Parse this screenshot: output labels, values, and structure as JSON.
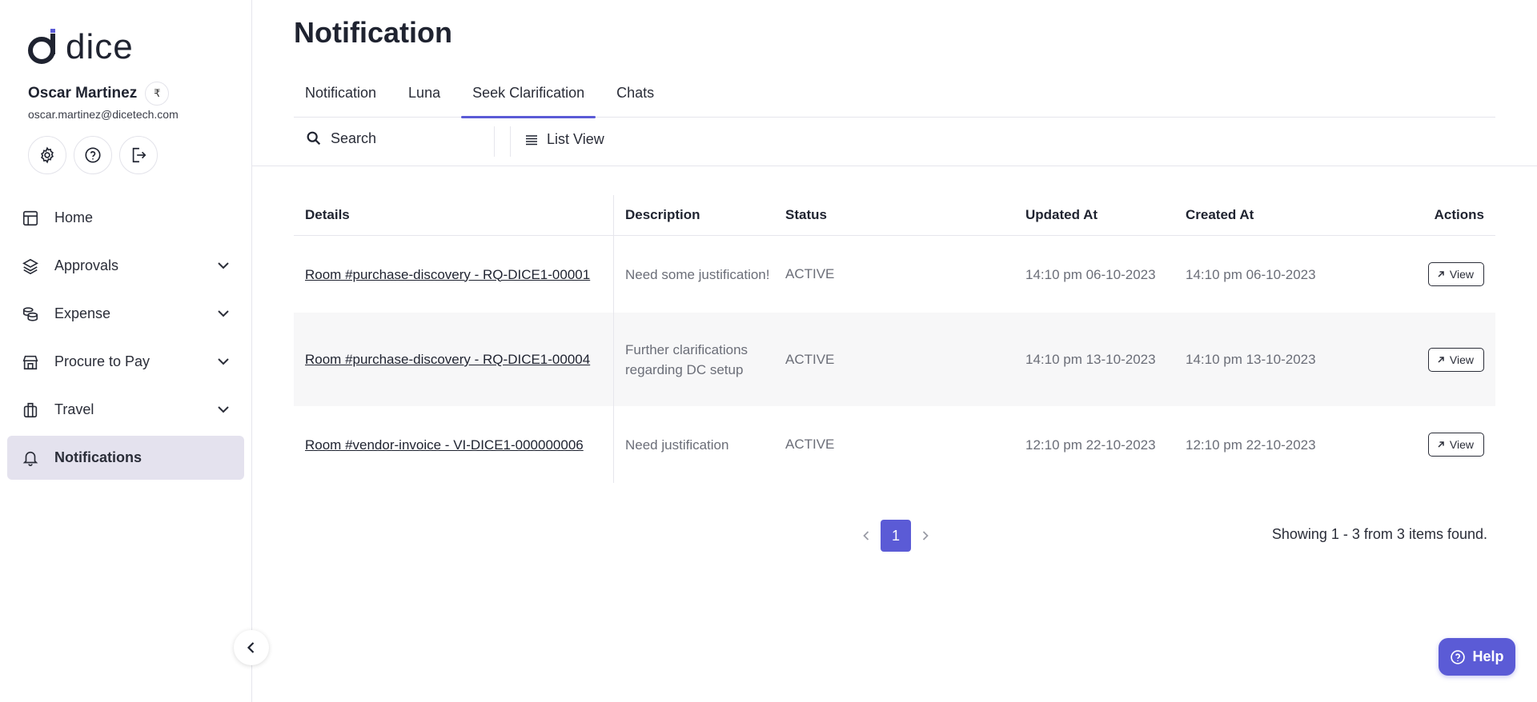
{
  "brand": {
    "name": "dice",
    "accent": "#5b5bd6"
  },
  "user": {
    "name": "Oscar Martinez",
    "currency_symbol": "₹",
    "email": "oscar.martinez@dicetech.com"
  },
  "quick_actions": [
    "gear-icon",
    "help-circle-icon",
    "logout-icon"
  ],
  "nav": {
    "items": [
      {
        "label": "Home",
        "icon": "layout-icon",
        "expandable": false
      },
      {
        "label": "Approvals",
        "icon": "layers-icon",
        "expandable": true
      },
      {
        "label": "Expense",
        "icon": "coins-icon",
        "expandable": true
      },
      {
        "label": "Procure to Pay",
        "icon": "store-icon",
        "expandable": true
      },
      {
        "label": "Travel",
        "icon": "luggage-icon",
        "expandable": true
      },
      {
        "label": "Notifications",
        "icon": "bell-icon",
        "expandable": false,
        "active": true
      }
    ]
  },
  "page": {
    "title": "Notification"
  },
  "tabs": [
    {
      "label": "Notification"
    },
    {
      "label": "Luna"
    },
    {
      "label": "Seek Clarification",
      "active": true
    },
    {
      "label": "Chats"
    }
  ],
  "toolbar": {
    "search_placeholder": "Search",
    "view_label": "List View"
  },
  "table": {
    "headers": {
      "details": "Details",
      "description": "Description",
      "status": "Status",
      "updated": "Updated At",
      "created": "Created At",
      "actions": "Actions"
    },
    "rows": [
      {
        "details": "Room #purchase-discovery - RQ-DICE1-00001",
        "description": "Need some justification!",
        "status": "ACTIVE",
        "updated": "14:10 pm 06-10-2023",
        "created": "14:10 pm 06-10-2023",
        "action": "View"
      },
      {
        "details": "Room #purchase-discovery - RQ-DICE1-00004",
        "description": "Further clarifications regarding DC setup",
        "status": "ACTIVE",
        "updated": "14:10 pm 13-10-2023",
        "created": "14:10 pm 13-10-2023",
        "action": "View"
      },
      {
        "details": "Room #vendor-invoice - VI-DICE1-000000006",
        "description": "Need justification",
        "status": "ACTIVE",
        "updated": "12:10 pm 22-10-2023",
        "created": "12:10 pm 22-10-2023",
        "action": "View"
      }
    ]
  },
  "pagination": {
    "current_page": "1",
    "summary": "Showing 1 - 3 from 3 items found."
  },
  "help": {
    "label": "Help"
  }
}
